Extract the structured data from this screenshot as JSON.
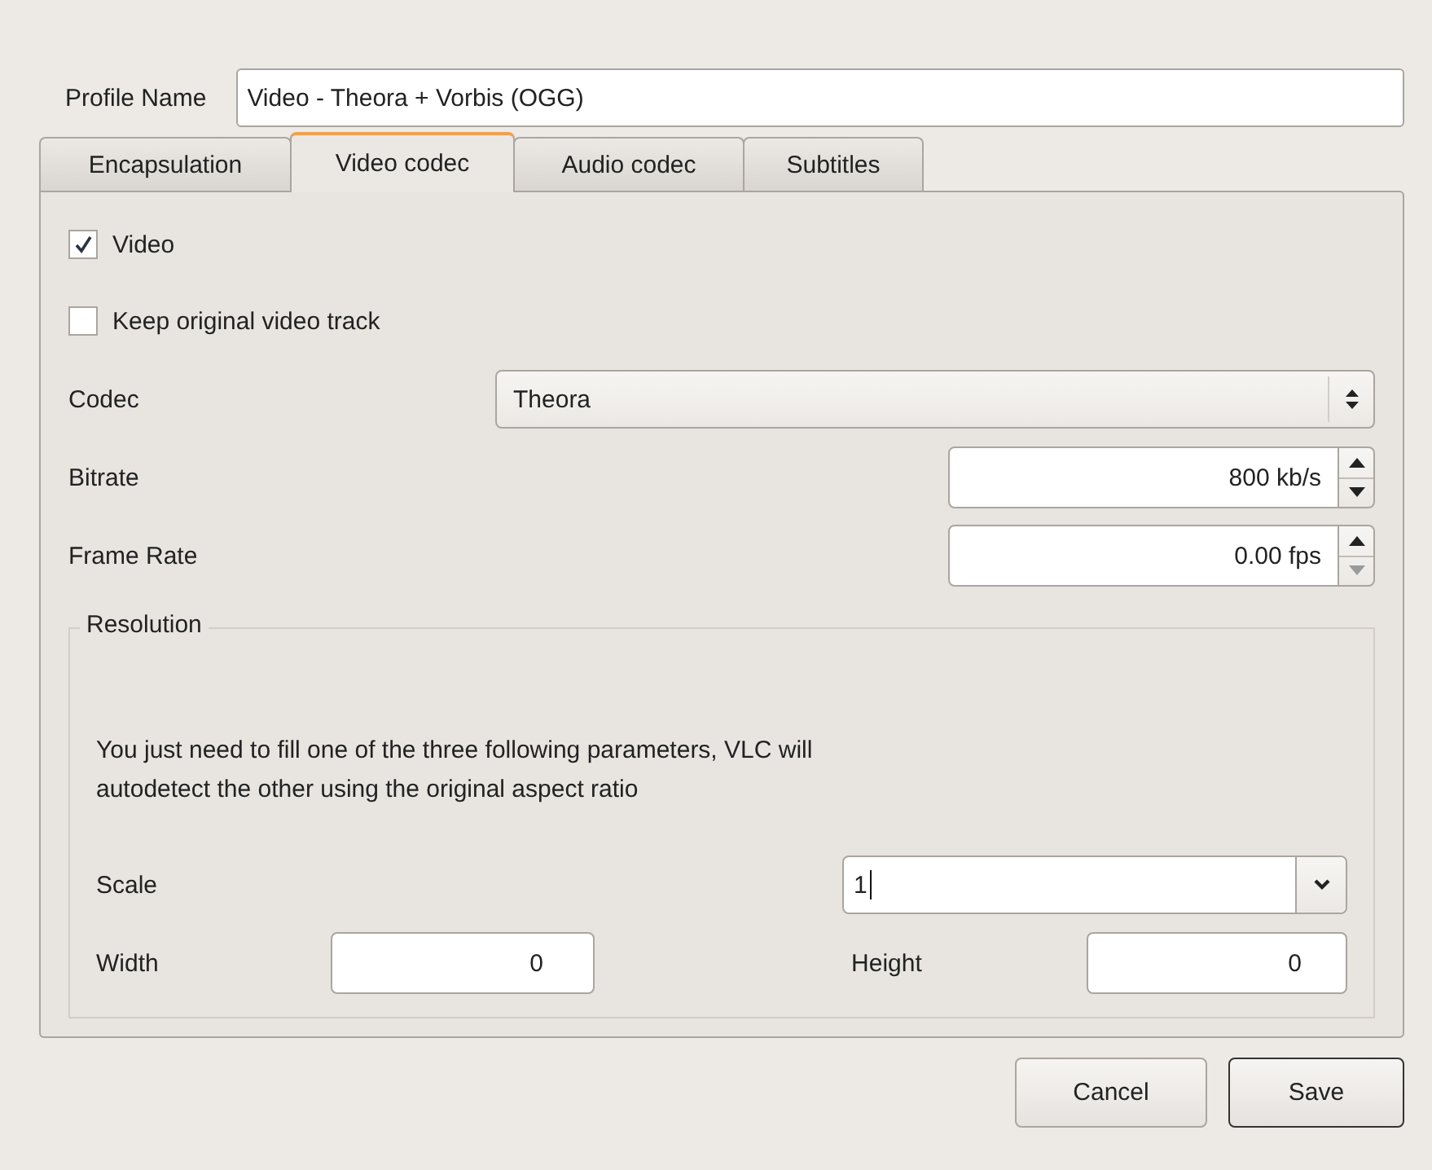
{
  "profile_name": {
    "label": "Profile Name",
    "value": "Video - Theora + Vorbis (OGG)"
  },
  "tabs": [
    {
      "label": "Encapsulation",
      "selected": false
    },
    {
      "label": "Video codec",
      "selected": true
    },
    {
      "label": "Audio codec",
      "selected": false
    },
    {
      "label": "Subtitles",
      "selected": false
    }
  ],
  "checkboxes": [
    {
      "label": "Video",
      "checked": true
    },
    {
      "label": "Keep original video track",
      "checked": false
    }
  ],
  "codec": {
    "label": "Codec",
    "value": "Theora"
  },
  "spinners": [
    {
      "label": "Bitrate",
      "value": "800 kb/s",
      "up_disabled": false,
      "down_disabled": false
    },
    {
      "label": "Frame Rate",
      "value": "0.00 fps",
      "up_disabled": false,
      "down_disabled": true
    }
  ],
  "resolution": {
    "title": "Resolution",
    "hint": "You just need to fill one of the three following parameters, VLC will\nautodetect the other using the original aspect ratio",
    "scale": {
      "label": "Scale",
      "value": "1"
    },
    "width": {
      "label": "Width",
      "value": "0"
    },
    "height": {
      "label": "Height",
      "value": "0"
    }
  },
  "buttons": [
    {
      "label": "Cancel",
      "default": false
    },
    {
      "label": "Save",
      "default": true
    }
  ]
}
